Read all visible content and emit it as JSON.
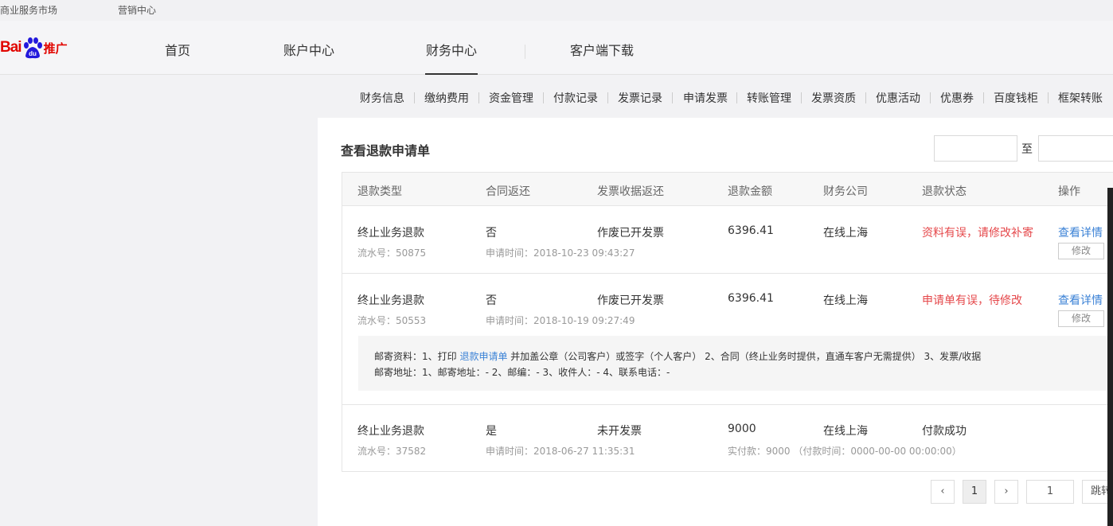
{
  "topbar": {
    "links": [
      "商业服务市场",
      "营销中心"
    ]
  },
  "logo": {
    "text_bai": "Bai",
    "text_du": "du",
    "text_product": "推广"
  },
  "nav": {
    "items": [
      "首页",
      "账户中心",
      "财务中心",
      "客户端下载"
    ],
    "active": "财务中心"
  },
  "subnav": {
    "items": [
      "财务信息",
      "缴纳费用",
      "资金管理",
      "付款记录",
      "发票记录",
      "申请发票",
      "转账管理",
      "发票资质",
      "优惠活动",
      "优惠券",
      "百度钱柜",
      "框架转账"
    ]
  },
  "panel": {
    "title": "查看退款申请单",
    "date_to": "至"
  },
  "table": {
    "headers": [
      "退款类型",
      "合同返还",
      "发票收据返还",
      "退款金额",
      "财务公司",
      "退款状态",
      "操作"
    ],
    "rows": [
      {
        "type": "终止业务退款",
        "serial": "流水号：50875",
        "contract": "否",
        "apply_time": "申请时间：2018-10-23 09:43:27",
        "invoice": "作废已开发票",
        "amount": "6396.41",
        "company": "在线上海",
        "status": "资料有误，请修改补寄",
        "view": "查看详情",
        "edit": "修改"
      },
      {
        "type": "终止业务退款",
        "serial": "流水号：50553",
        "contract": "否",
        "apply_time": "申请时间：2018-10-19 09:27:49",
        "invoice": "作废已开发票",
        "amount": "6396.41",
        "company": "在线上海",
        "status": "申请单有误，待修改",
        "view": "查看详情",
        "edit": "修改",
        "mail_prefix": "邮寄资料：1、打印 ",
        "mail_link": "退款申请单",
        "mail_suffix": " 并加盖公章（公司客户）或签字（个人客户） 2、合同（终止业务时提供，直通车客户无需提供） 3、发票/收据",
        "mail_address": "邮寄地址：1、邮寄地址：- 2、邮编：- 3、收件人：- 4、联系电话：-"
      },
      {
        "type": "终止业务退款",
        "serial": "流水号：37582",
        "contract": "是",
        "apply_time": "申请时间：2018-06-27 11:35:31",
        "invoice": "未开发票",
        "amount": "9000",
        "company": "在线上海",
        "status": "付款成功",
        "paid": "实付款：9000 （付款时间：0000-00-00 00:00:00）"
      }
    ]
  },
  "pager": {
    "prev": "‹",
    "current": "1",
    "next": "›",
    "jump_value": "1",
    "jump_label": "跳转"
  },
  "colors": {
    "error": "#e5474a",
    "link": "#3b82d6",
    "brand": "#e10601"
  }
}
